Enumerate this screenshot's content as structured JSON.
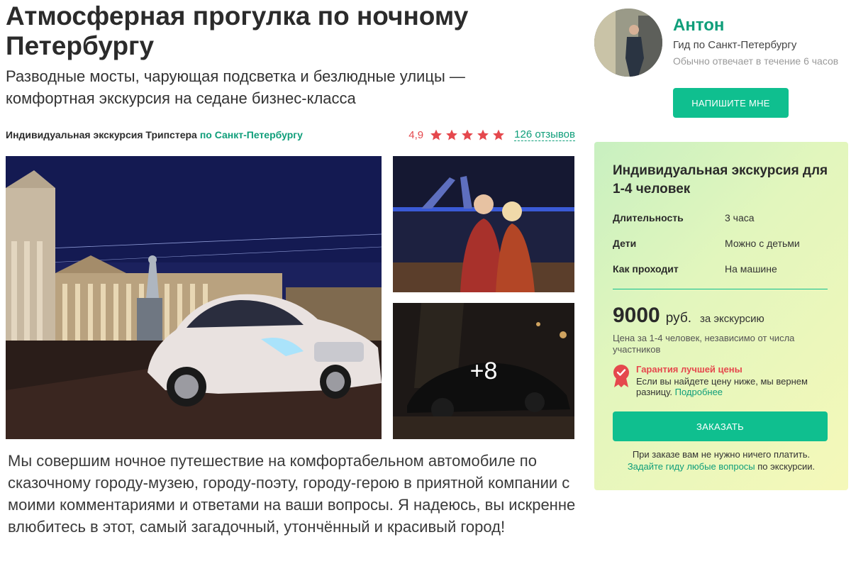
{
  "tour": {
    "title": "Атмосферная прогулка по ночному Петербургу",
    "subtitle": "Разводные мосты, чарующая подсветка и безлюдные улицы — комфортная экскурсия на седане бизнес-класса",
    "type_label": "Индивидуальная экскурсия Трипстера",
    "city_link": "по Санкт-Петербургу",
    "rating": "4,9",
    "stars": 5,
    "reviews_link": "126 отзывов",
    "more_photos": "+8",
    "description": "Мы совершим ночное путешествие на комфортабельном автомобиле по сказочному городу-музею, городу-поэту, городу-герою в приятной компании с моими комментариями и ответами на ваши вопросы. Я надеюсь, вы искренне влюбитесь в этот, самый загадочный, утончённый и красивый город!"
  },
  "guide": {
    "name": "Антон",
    "role": "Гид по Санкт-Петербургу",
    "reply_time": "Обычно отвечает в течение 6 часов",
    "write_button": "НАПИШИТЕ МНЕ"
  },
  "booking": {
    "title": "Индивидуальная экскурсия для 1-4 человек",
    "props": [
      {
        "key": "Длительность",
        "value": "3 часа"
      },
      {
        "key": "Дети",
        "value": "Можно с детьми"
      },
      {
        "key": "Как проходит",
        "value": "На машине"
      }
    ],
    "price": "9000",
    "currency": "руб.",
    "price_per": "за экскурсию",
    "price_note": "Цена за 1-4 человек, независимо от числа участников",
    "guarantee_title": "Гарантия лучшей цены",
    "guarantee_text": "Если вы найдете цену ниже, мы вернем разницу.",
    "guarantee_link": "Подробнее",
    "order_button": "ЗАКАЗАТЬ",
    "order_note_1": "При заказе вам не нужно ничего платить.",
    "order_note_link": "Задайте гиду любые вопросы",
    "order_note_2": "по экскурсии."
  },
  "colors": {
    "accent": "#0fbf8f",
    "link": "#0f9e7a",
    "rating": "#e5484d"
  }
}
